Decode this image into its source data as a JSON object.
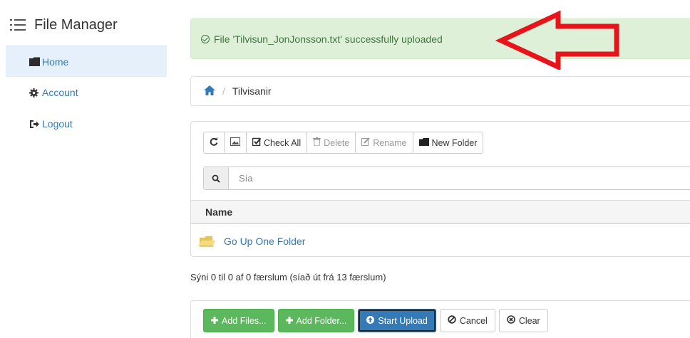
{
  "brand": {
    "title": "File Manager",
    "icon": "list-icon"
  },
  "sidebar": {
    "items": [
      {
        "label": "Home",
        "icon": "folder-icon",
        "active": true
      },
      {
        "label": "Account",
        "icon": "cog-icon",
        "active": false
      },
      {
        "label": "Logout",
        "icon": "logout-icon",
        "active": false
      }
    ]
  },
  "alert": {
    "message": "File 'Tilvisun_JonJonsson.txt' successfully uploaded",
    "icon": "check-circle-icon"
  },
  "annotation": {
    "arrow_color": "#e8141b"
  },
  "breadcrumb": {
    "folder": "Tilvisanir",
    "separator": "/"
  },
  "toolbar": {
    "check_all": "Check All",
    "delete": "Delete",
    "rename": "Rename",
    "new_folder": "New Folder"
  },
  "search": {
    "placeholder": "Sía",
    "value": ""
  },
  "table": {
    "header": "Name",
    "rows": [
      {
        "label": "Go Up One Folder",
        "icon": "folder-up-icon"
      }
    ]
  },
  "info": {
    "text": "Sýni 0 til 0 af 0 færslum (síað út frá 13 færslum)"
  },
  "upload": {
    "add_files": "Add Files...",
    "add_folder": "Add Folder...",
    "start_upload": "Start Upload",
    "cancel": "Cancel",
    "clear": "Clear"
  },
  "colors": {
    "link": "#337ab7",
    "success_bg": "#dff0d8",
    "success_text": "#3c763d",
    "green_button": "#5cb85c",
    "primary_button": "#337ab7"
  }
}
